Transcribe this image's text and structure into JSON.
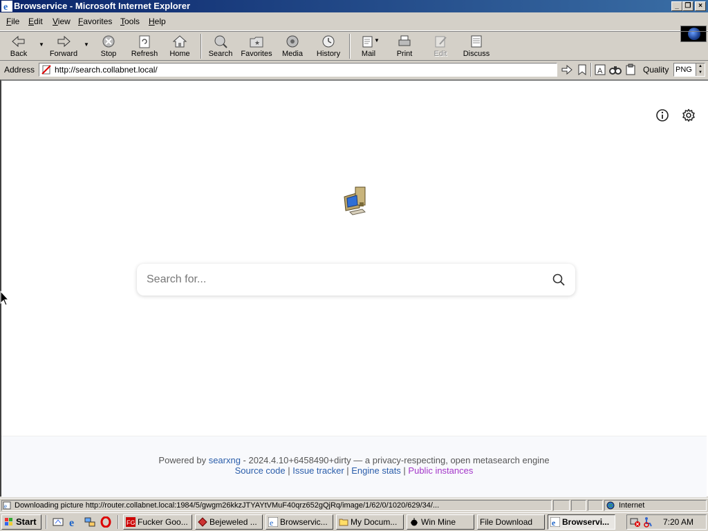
{
  "window": {
    "title": "Browservice - Microsoft Internet Explorer",
    "minimize_glyph": "_",
    "restore_glyph": "❐",
    "close_glyph": "×"
  },
  "menu": [
    {
      "key": "F",
      "rest": "ile"
    },
    {
      "key": "E",
      "rest": "dit"
    },
    {
      "key": "V",
      "rest": "iew"
    },
    {
      "key": "",
      "pre": "F",
      "rest": "avorites",
      "label": "Favorites"
    },
    {
      "key": "T",
      "rest": "ools"
    },
    {
      "key": "H",
      "rest": "elp"
    }
  ],
  "menu_labels": {
    "file": "File",
    "edit": "Edit",
    "view": "View",
    "favorites": "Favorites",
    "tools": "Tools",
    "help": "Help"
  },
  "toolbar": {
    "back": "Back",
    "forward": "Forward",
    "stop": "Stop",
    "refresh": "Refresh",
    "home": "Home",
    "search": "Search",
    "favorites": "Favorites",
    "media": "Media",
    "history": "History",
    "mail": "Mail",
    "print": "Print",
    "edit": "Edit",
    "discuss": "Discuss"
  },
  "address": {
    "label": "Address",
    "url": "http://search.collabnet.local/",
    "quality_label": "Quality",
    "quality_value": "PNG"
  },
  "page": {
    "search_placeholder": "Search for...",
    "footer": {
      "powered_by": "Powered by ",
      "engine_link": "searxng",
      "version_text": " - 2024.4.10+6458490+dirty — a privacy-respecting, open metasearch engine",
      "source_code": "Source code",
      "sep": " | ",
      "issue_tracker": "Issue tracker",
      "engine_stats": "Engine stats",
      "public_instances": "Public instances"
    }
  },
  "status": {
    "text": "Downloading picture http://router.collabnet.local:1984/5/gwgm26kkzJTYAYtVMuF40qrz652gQjRq/image/1/62/0/1020/629/34/...",
    "zone": "Internet"
  },
  "taskbar": {
    "start": "Start",
    "tasks": [
      {
        "label": "Fucker Goo..."
      },
      {
        "label": "Bejeweled ..."
      },
      {
        "label": "Browservic..."
      },
      {
        "label": "My Docum..."
      },
      {
        "label": "Win Mine"
      },
      {
        "label": "File Download"
      },
      {
        "label": "Browservi..."
      }
    ],
    "clock": "7:20 AM"
  },
  "colors": {
    "titlebar_start": "#0a246a",
    "titlebar_end": "#3a6ea5",
    "chrome": "#d4d0c8",
    "link": "#2a5daa",
    "visited_link": "#a336c9"
  }
}
